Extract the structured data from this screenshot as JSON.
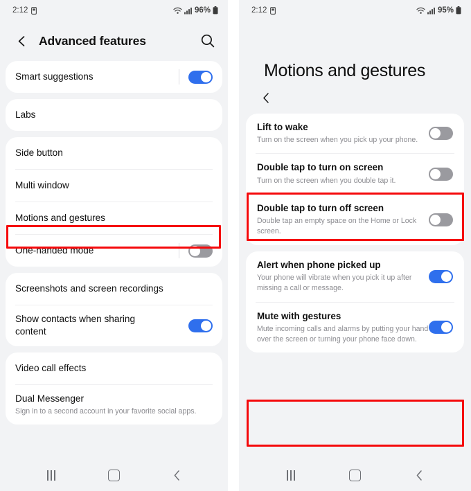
{
  "left": {
    "status": {
      "time": "2:12",
      "battery_pct": "96%",
      "wifi_icon": "wifi-icon",
      "signal_icon": "cellular-signal-icon",
      "battery_icon": "battery-icon",
      "alarm_icon": "sim-card-icon"
    },
    "appbar": {
      "title": "Advanced features",
      "back_icon": "chevron-left-icon",
      "search_icon": "search-icon"
    },
    "groups": [
      {
        "rows": [
          {
            "title": "Smart suggestions",
            "toggle": "on",
            "has_separator": true
          }
        ]
      },
      {
        "rows": [
          {
            "title": "Labs"
          }
        ]
      },
      {
        "rows": [
          {
            "title": "Side button"
          },
          {
            "title": "Multi window"
          },
          {
            "title": "Motions and gestures",
            "highlighted": true
          },
          {
            "title": "One-handed mode",
            "toggle": "off",
            "has_separator": true
          }
        ]
      },
      {
        "rows": [
          {
            "title": "Screenshots and screen recordings"
          },
          {
            "title": "Show contacts when sharing content",
            "toggle": "on"
          }
        ]
      },
      {
        "rows": [
          {
            "title": "Video call effects"
          },
          {
            "title": "Dual Messenger",
            "subtitle": "Sign in to a second account in your favorite social apps."
          }
        ]
      }
    ],
    "navbar": {
      "recents": "recents-icon",
      "home": "home-icon",
      "back": "back-icon"
    }
  },
  "right": {
    "status": {
      "time": "2:12",
      "battery_pct": "95%",
      "wifi_icon": "wifi-icon",
      "signal_icon": "cellular-signal-icon",
      "battery_icon": "battery-icon",
      "alarm_icon": "sim-card-icon"
    },
    "page_title": "Motions and gestures",
    "back_icon": "chevron-left-icon",
    "groups": [
      {
        "rows": [
          {
            "title": "Lift to wake",
            "subtitle": "Turn on the screen when you pick up your phone.",
            "toggle": "off",
            "highlighted": true
          },
          {
            "title": "Double tap to turn on screen",
            "subtitle": "Turn on the screen when you double tap it.",
            "toggle": "off"
          },
          {
            "title": "Double tap to turn off screen",
            "subtitle": "Double tap an empty space on the Home or Lock screen.",
            "toggle": "off"
          }
        ]
      },
      {
        "rows": [
          {
            "title": "Alert when phone picked up",
            "subtitle": "Your phone will vibrate when you pick it up after missing a call or message.",
            "toggle": "on"
          },
          {
            "title": "Mute with gestures",
            "subtitle": "Mute incoming calls and alarms by putting your hand over the screen or turning your phone face down.",
            "toggle": "on",
            "highlighted": true
          }
        ]
      }
    ],
    "navbar": {
      "recents": "recents-icon",
      "home": "home-icon",
      "back": "back-icon"
    }
  },
  "colors": {
    "accent_on": "#2f6fed",
    "toggle_off": "#9a9a9f",
    "highlight": "#f5090b",
    "page_bg": "#f2f3f5",
    "card_bg": "#ffffff"
  }
}
